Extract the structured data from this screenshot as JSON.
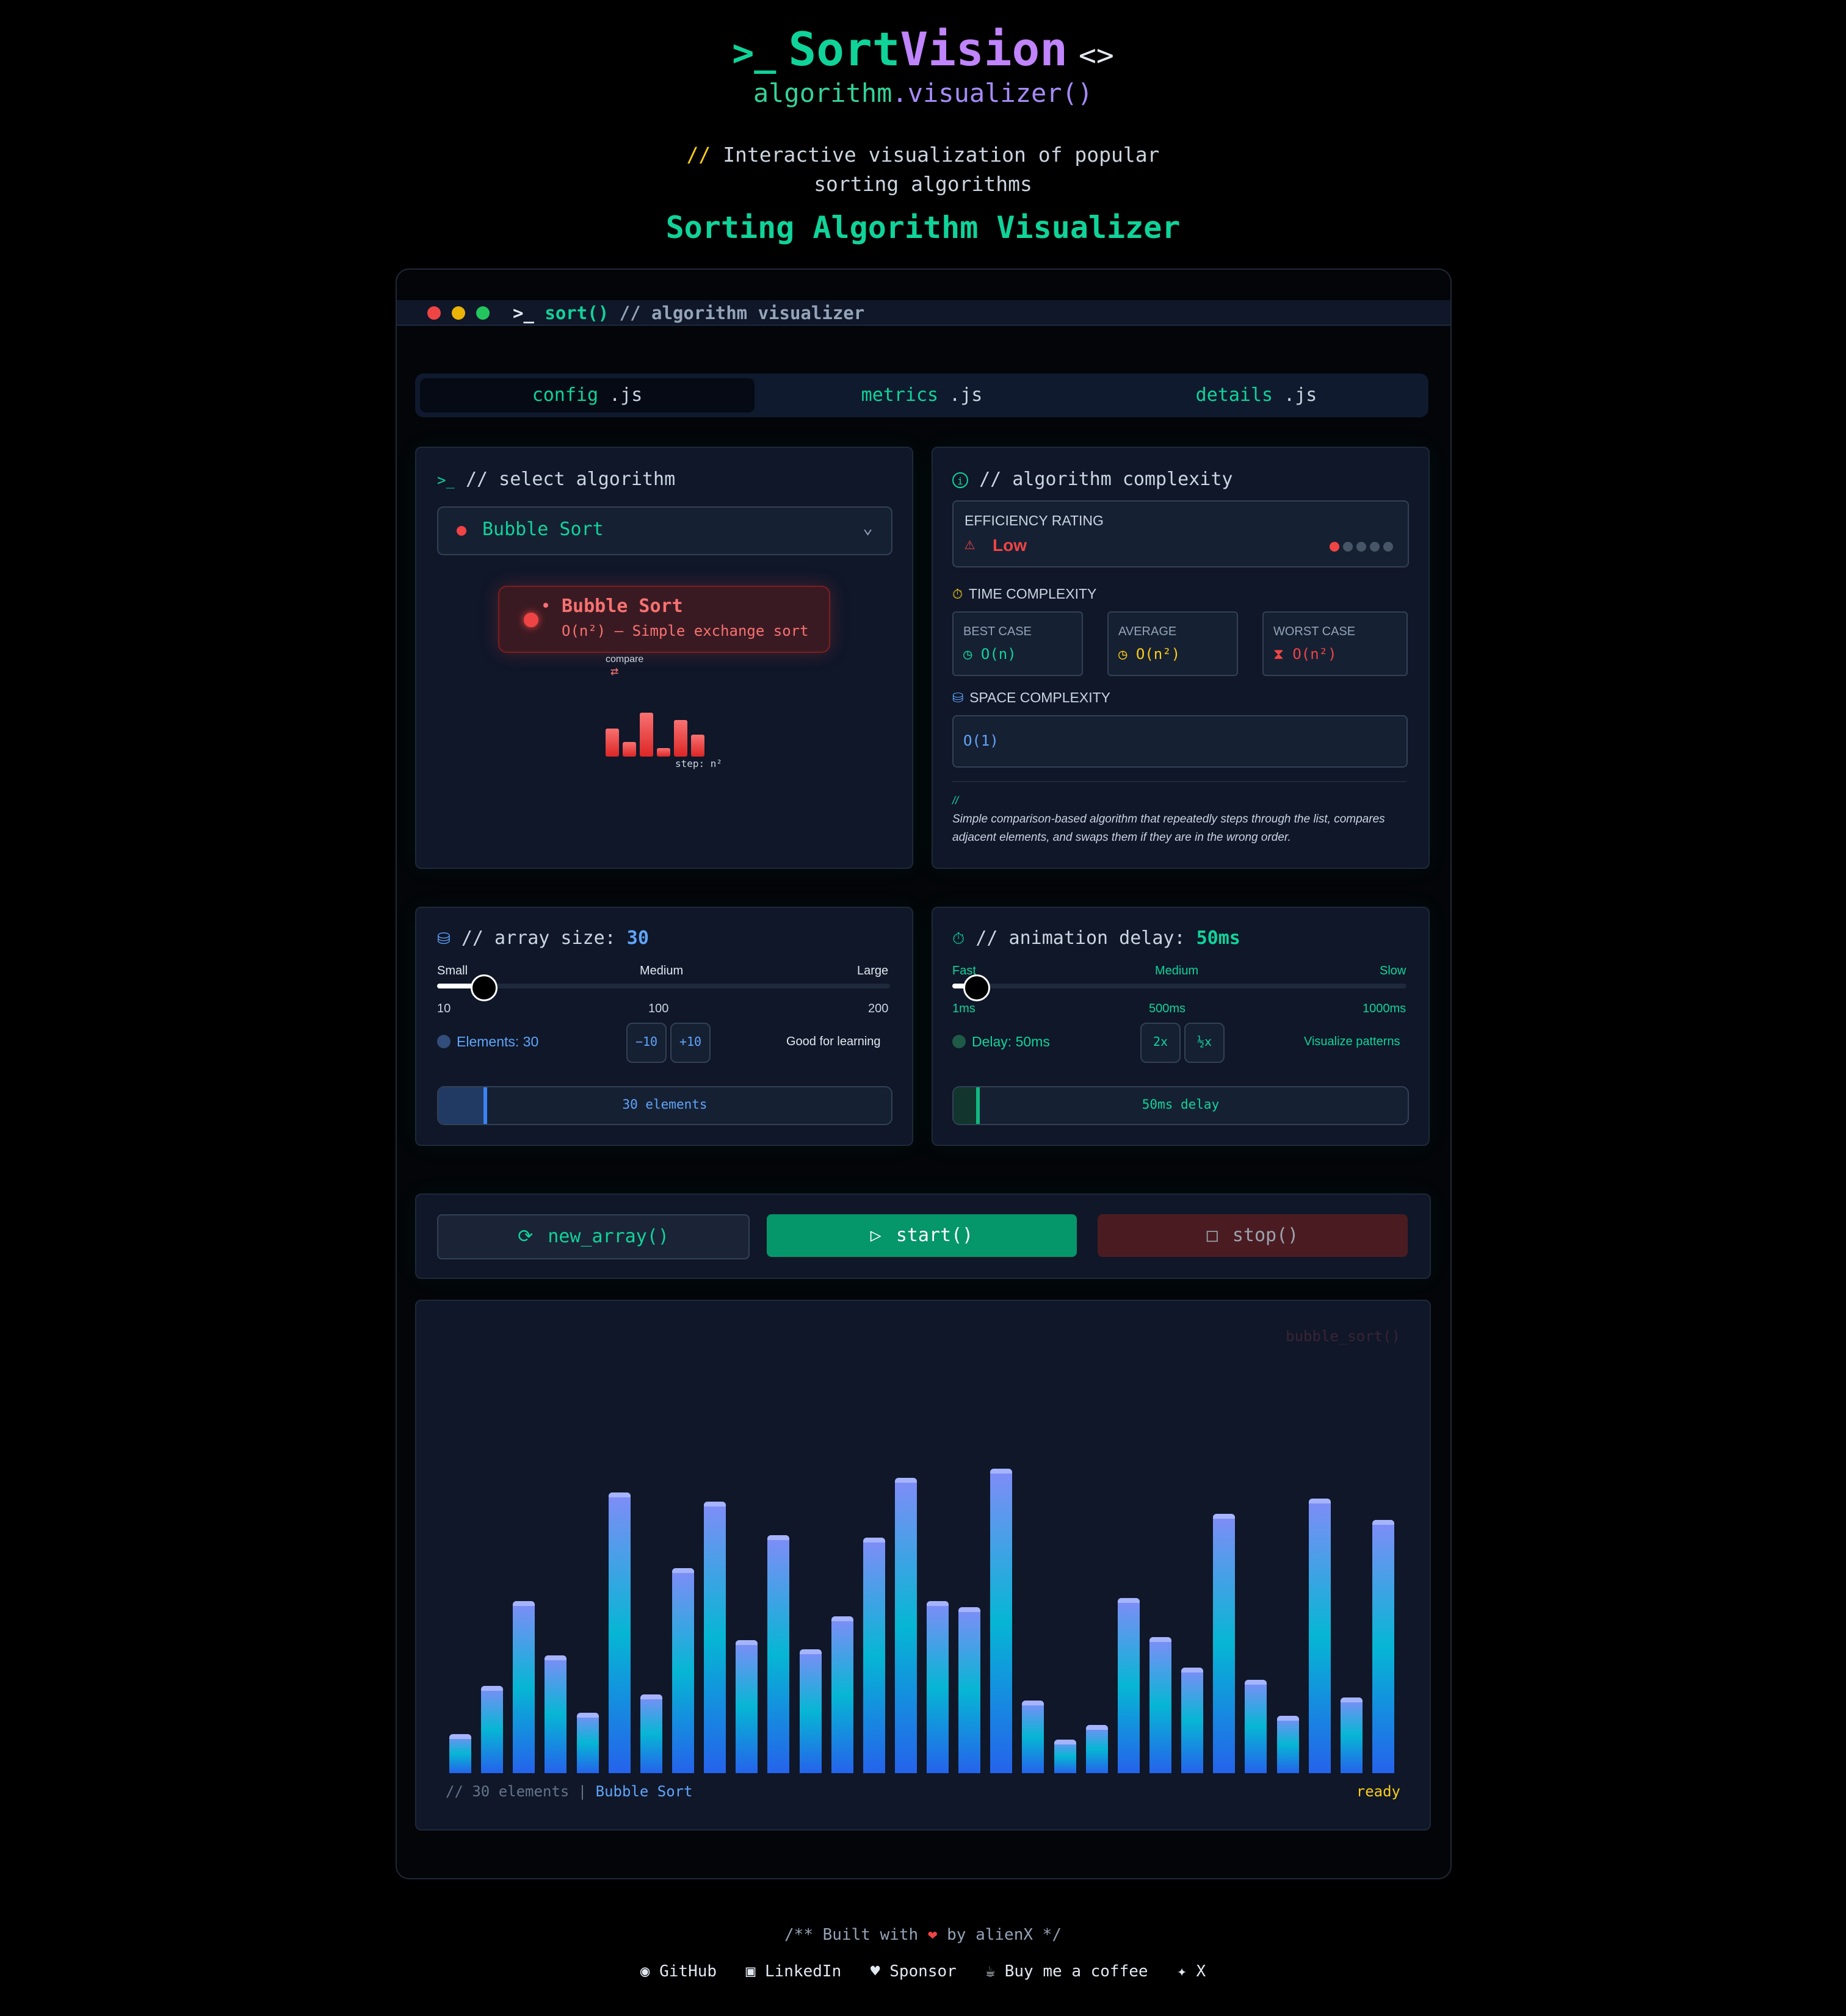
{
  "header": {
    "brand_sort": "Sort",
    "brand_vision": "Vision",
    "subtitle_a": "algorithm",
    "subtitle_b": ".visualizer()",
    "tagline_comment": "//",
    "tagline": "Interactive visualization of popular sorting algorithms",
    "title": "Sorting Algorithm Visualizer"
  },
  "window": {
    "title_fn": "sort()",
    "title_comment": "// algorithm visualizer"
  },
  "tabs": [
    {
      "name": "config",
      "ext": ".js"
    },
    {
      "name": "metrics",
      "ext": ".js"
    },
    {
      "name": "details",
      "ext": ".js"
    }
  ],
  "select_card": {
    "heading": "// select algorithm",
    "selected": "Bubble Sort",
    "popup_name": "Bubble Sort",
    "popup_desc": "O(n²) – Simple exchange sort",
    "compare_label": "compare",
    "step_label": "step: n²"
  },
  "complexity_card": {
    "heading": "// algorithm complexity",
    "efficiency_label": "EFFICIENCY RATING",
    "efficiency_value": "Low",
    "efficiency_dots": 1,
    "time_label": "TIME COMPLEXITY",
    "best_label": "BEST CASE",
    "best_value": "O(n)",
    "avg_label": "AVERAGE",
    "avg_value": "O(n²)",
    "worst_label": "WORST CASE",
    "worst_value": "O(n²)",
    "space_label": "SPACE COMPLEXITY",
    "space_value": "O(1)",
    "note_comment": "//",
    "note": "Simple comparison-based algorithm that repeatedly steps through the list, compares adjacent elements, and swaps them if they are in the wrong order."
  },
  "size_card": {
    "heading": "// array size:",
    "value": "30",
    "level": 0.1,
    "labels": [
      "Small",
      "Medium",
      "Large"
    ],
    "ticks": [
      "10",
      "100",
      "200"
    ],
    "elements": "Elements: 30",
    "minus": "−10",
    "plus": "+10",
    "hint": "Good for learning",
    "progress": "30 elements"
  },
  "delay_card": {
    "heading": "// animation delay:",
    "value": "50ms",
    "level": 0.05,
    "labels": [
      "Fast",
      "Medium",
      "Slow"
    ],
    "ticks": [
      "1ms",
      "500ms",
      "1000ms"
    ],
    "delay": "Delay: 50ms",
    "btn2x": "2x",
    "btnhalf": "½x",
    "hint": "Visualize patterns",
    "progress": "50ms delay"
  },
  "actions": {
    "new_array": "new_array()",
    "start": "start()",
    "stop": "stop()"
  },
  "viz": {
    "watermark": "bubble_sort()",
    "footer_count": "// 30 elements |",
    "footer_algo": "Bubble Sort",
    "status": "ready",
    "chart_data": {
      "type": "bar",
      "values": [
        9,
        25,
        53,
        35,
        16,
        89,
        22,
        64,
        86,
        40,
        75,
        37,
        48,
        74,
        94,
        53,
        51,
        97,
        20,
        7,
        12,
        54,
        41,
        31,
        82,
        27,
        15,
        87,
        21,
        80
      ]
    }
  },
  "footer": {
    "built": "/** Built with",
    "by": "by alienX */",
    "heart": "❤",
    "links": [
      "GitHub",
      "LinkedIn",
      "Sponsor",
      "Buy me a coffee",
      "X"
    ]
  },
  "colors": {
    "accent": "#10d39a",
    "purple": "#c084fc",
    "danger": "#ef4444",
    "warning": "#facc15",
    "info": "#60a5fa"
  }
}
